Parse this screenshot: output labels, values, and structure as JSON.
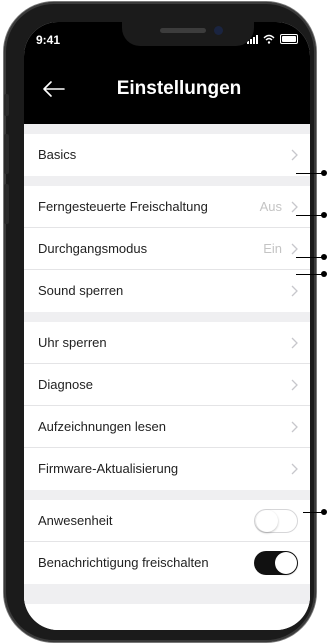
{
  "status_bar": {
    "time": "9:41"
  },
  "nav": {
    "title": "Einstellungen"
  },
  "sections": [
    {
      "rows": [
        {
          "label": "Basics",
          "value": ""
        }
      ]
    },
    {
      "rows": [
        {
          "label": "Ferngesteuerte Freischaltung",
          "value": "Aus"
        },
        {
          "label": "Durchgangsmodus",
          "value": "Ein"
        },
        {
          "label": "Sound sperren",
          "value": ""
        }
      ]
    },
    {
      "rows": [
        {
          "label": "Uhr sperren",
          "value": ""
        },
        {
          "label": "Diagnose",
          "value": ""
        },
        {
          "label": "Aufzeichnungen lesen",
          "value": ""
        },
        {
          "label": "Firmware-Aktualisierung",
          "value": ""
        }
      ]
    },
    {
      "rows": [
        {
          "label": "Anwesenheit",
          "toggle": false
        },
        {
          "label": "Benachrichtigung freischalten",
          "toggle": true
        }
      ]
    }
  ],
  "colors": {
    "bar": "#000000",
    "separator": "#efeff1",
    "toggle_on": "#111111"
  }
}
